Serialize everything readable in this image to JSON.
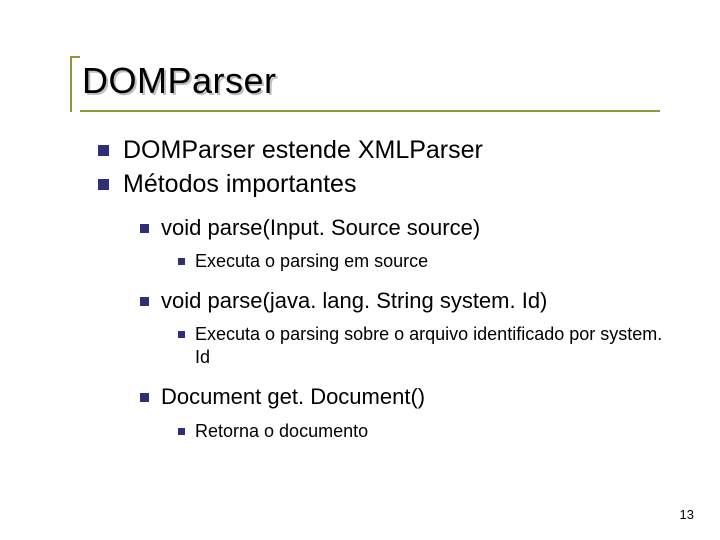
{
  "title": "DOMParser",
  "bullets_lvl1": [
    "DOMParser estende XMLParser",
    "Métodos importantes"
  ],
  "methods": [
    {
      "signature": "void parse(Input. Source source)",
      "desc": "Executa o parsing em source"
    },
    {
      "signature": "void parse(java. lang. String system. Id)",
      "desc": "Executa o parsing sobre o arquivo identificado por system. Id"
    },
    {
      "signature": "Document get. Document()",
      "desc": "Retorna o documento"
    }
  ],
  "page_number": "13"
}
